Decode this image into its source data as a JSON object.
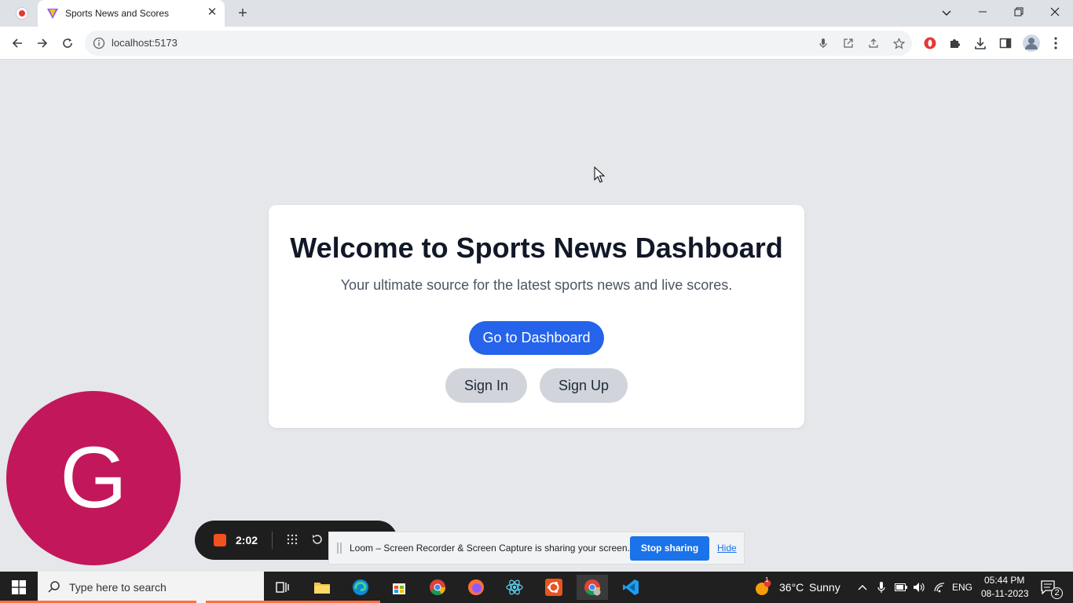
{
  "browser": {
    "tab_title": "Sports News and Scores",
    "url": "localhost:5173"
  },
  "page": {
    "heading": "Welcome to Sports News Dashboard",
    "subheading": "Your ultimate source for the latest sports news and live scores.",
    "dashboard_button": "Go to Dashboard",
    "signin_button": "Sign In",
    "signup_button": "Sign Up"
  },
  "loom": {
    "avatar_letter": "G",
    "timer": "2:02",
    "share_message": "Loom – Screen Recorder & Screen Capture is sharing your screen.",
    "stop_sharing": "Stop sharing",
    "hide": "Hide"
  },
  "taskbar": {
    "search_placeholder": "Type here to search",
    "weather_temp": "36°C",
    "weather_desc": "Sunny",
    "weather_badge": "1",
    "language": "ENG",
    "time": "05:44 PM",
    "date": "08-11-2023",
    "notification_count": "2"
  },
  "colors": {
    "primary": "#2563eb",
    "avatar": "#c2185b",
    "record": "#f4511e"
  }
}
